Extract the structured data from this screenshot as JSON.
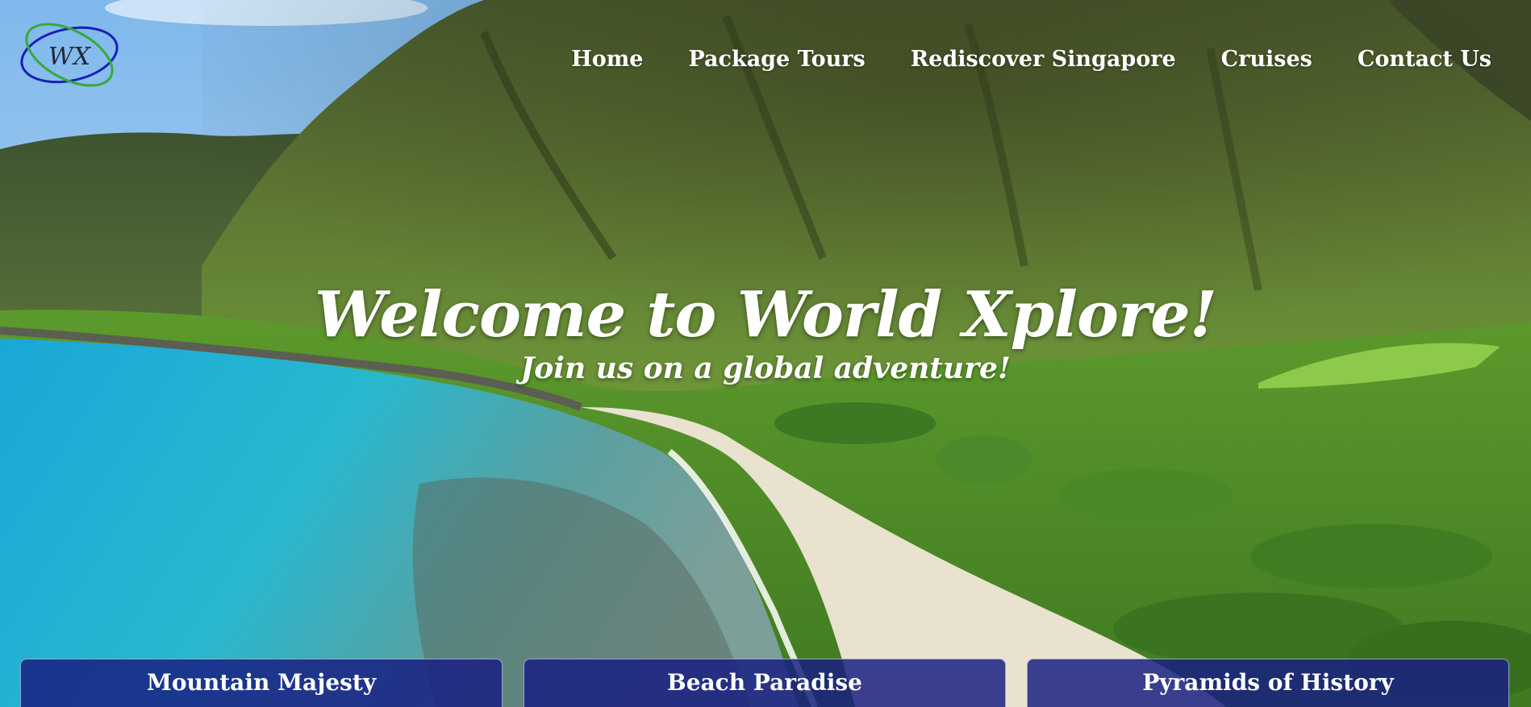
{
  "logo": {
    "text": "WX"
  },
  "nav": {
    "items": [
      {
        "label": "Home"
      },
      {
        "label": "Package Tours"
      },
      {
        "label": "Rediscover Singapore"
      },
      {
        "label": "Cruises"
      },
      {
        "label": "Contact Us"
      }
    ]
  },
  "hero": {
    "title": "Welcome to World Xplore!",
    "subtitle": "Join us on a global adventure!"
  },
  "cards": [
    {
      "title": "Mountain Majesty"
    },
    {
      "title": "Beach Paradise"
    },
    {
      "title": "Pyramids of History"
    }
  ],
  "colors": {
    "card_background": "#1c2284",
    "nav_text": "#ffffff",
    "logo_ring_blue": "#1a1fb8",
    "logo_ring_green": "#3aa83a"
  }
}
